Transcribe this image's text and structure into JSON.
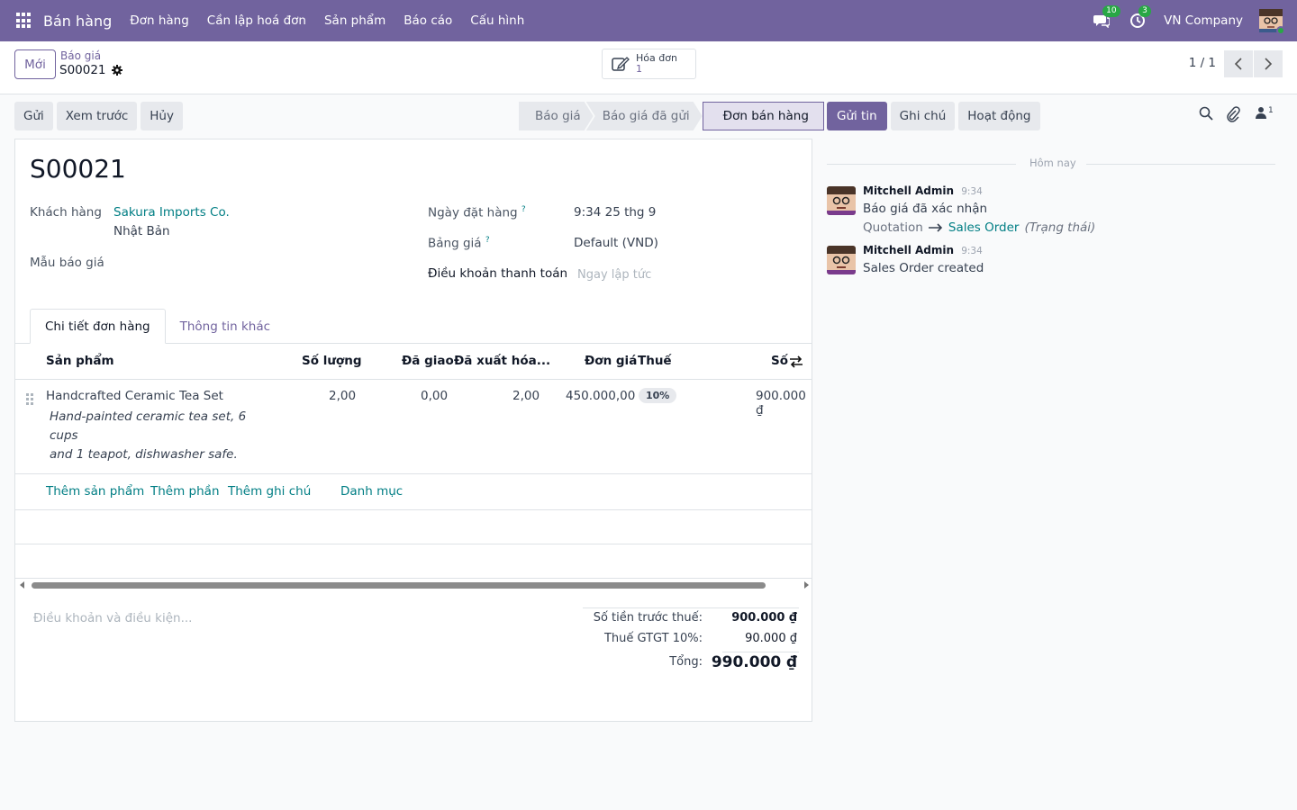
{
  "navbar": {
    "app_name": "Bán hàng",
    "menu": [
      "Đơn hàng",
      "Cần lập hoá đơn",
      "Sản phẩm",
      "Báo cáo",
      "Cấu hình"
    ],
    "messages_count": "10",
    "activities_count": "3",
    "company": "VN Company"
  },
  "control": {
    "new_label": "Mới",
    "breadcrumb_parent": "Báo giá",
    "breadcrumb_current": "S00021",
    "smart_button_label": "Hóa đơn",
    "smart_button_value": "1",
    "pager": "1 / 1"
  },
  "actions": {
    "send": "Gửi",
    "preview": "Xem trước",
    "cancel": "Hủy"
  },
  "statusbar": {
    "stages": [
      "Báo giá",
      "Báo giá đã gửi",
      "Đơn bán hàng"
    ],
    "active": "Đơn bán hàng"
  },
  "form": {
    "title": "S00021",
    "customer_label": "Khách hàng",
    "customer_name": "Sakura Imports Co.",
    "customer_country": "Nhật Bản",
    "template_label": "Mẫu báo giá",
    "order_date_label": "Ngày đặt hàng",
    "order_date_value": "9:34 25 thg 9",
    "pricelist_label": "Bảng giá",
    "pricelist_value": "Default (VND)",
    "payment_terms_label": "Điều khoản thanh toán",
    "payment_terms_placeholder": "Ngay lập tức",
    "help_mark": "?"
  },
  "tabs": [
    "Chi tiết đơn hàng",
    "Thông tin khác"
  ],
  "table": {
    "headers": {
      "product": "Sản phẩm",
      "quantity": "Số lượng",
      "delivered": "Đã giao",
      "invoiced": "Đã xuất hóa...",
      "unit_price": "Đơn giá",
      "taxes": "Thuế",
      "subtotal": "Số"
    },
    "rows": [
      {
        "product": "Handcrafted Ceramic Tea Set",
        "description_line1": "Hand-painted ceramic tea set, 6 cups",
        "description_line2": "and 1 teapot, dishwasher safe.",
        "quantity": "2,00",
        "delivered": "0,00",
        "invoiced": "2,00",
        "unit_price": "450.000,00",
        "tax": "10%",
        "subtotal": "900.000 ₫"
      }
    ],
    "add_product": "Thêm sản phẩm",
    "add_section": "Thêm phần",
    "add_note": "Thêm ghi chú",
    "catalog": "Danh mục"
  },
  "footer": {
    "terms_placeholder": "Điều khoản và điều kiện...",
    "untaxed_label": "Số tiền trước thuế:",
    "untaxed_value": "900.000 ₫",
    "vat_label": "Thuế GTGT 10%:",
    "vat_value": "90.000 ₫",
    "total_label": "Tổng:",
    "total_value": "990.000 ₫"
  },
  "chatter": {
    "send_message": "Gửi tin",
    "log_note": "Ghi chú",
    "activity": "Hoạt động",
    "followers_count": "1",
    "today": "Hôm nay",
    "messages": [
      {
        "author": "Mitchell Admin",
        "time": "9:34",
        "body": "Báo giá đã xác nhận",
        "track_old": "Quotation",
        "track_new": "Sales Order",
        "track_field": "(Trạng thái)"
      },
      {
        "author": "Mitchell Admin",
        "time": "9:34",
        "body": "Sales Order created"
      }
    ]
  },
  "colors": {
    "brand": "#71639e",
    "link": "#017e84",
    "badge_green": "#28a745"
  }
}
